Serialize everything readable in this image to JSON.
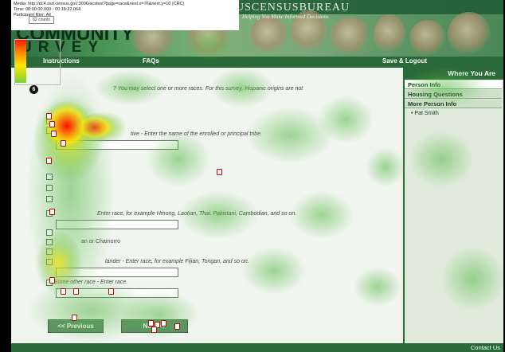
{
  "session_info": {
    "media": "Media: http://dc4.ssd.census.gov:3006/acstest?page=race&next.x=76&next.y=10 (CRC)",
    "time": "Time: 00:00:00.000 - 00:18:22.064",
    "participant": "Participant filter: All"
  },
  "legend": {
    "label": "62 counts"
  },
  "header": {
    "agency": "USCENSUSBUREAU",
    "tagline": "Helping You Make Informed Decisions",
    "logo_line1": "COMMUNITY",
    "logo_line2": "URVEY"
  },
  "nav": {
    "instructions": "Instructions",
    "faqs": "FAQs",
    "save_logout": "Save & Logout"
  },
  "sidebar": {
    "title": "Where You Are",
    "items": [
      "Person Info",
      "Housing Questions",
      "More Person Info",
      "• Pat Smith"
    ]
  },
  "question": {
    "number": "6",
    "prompt_fragment": "? You may select one or more races. For this survey, Hispanic origins are not",
    "tribe_hint": "tive - Enter the name of the enrolled or principal tribe.",
    "asian_hint": "Enter race, for example Hmong, Laotian, Thai, Pakistani, Cambodian, and so on.",
    "chamorro": "an or Chamorro",
    "pacific_hint": "lander - Enter race, for example Fijian, Tongan, and so on.",
    "some_other": "Some other race - Enter race."
  },
  "buttons": {
    "previous": "<< Previous",
    "next": "Next >>"
  },
  "footer": {
    "contact": "Contact Us"
  },
  "colors": {
    "brand_green": "#2a6a38",
    "heat_hot": "#ff1a00",
    "heat_warm": "#ffe800",
    "heat_cool": "#7ad13b"
  }
}
